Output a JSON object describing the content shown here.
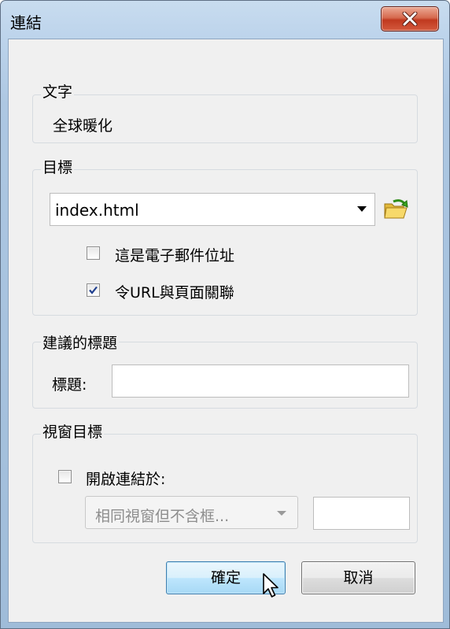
{
  "window": {
    "title": "連結"
  },
  "text_section": {
    "label": "文字",
    "value": "全球暖化"
  },
  "target_section": {
    "label": "目標",
    "combo_value": "index.html",
    "email_checkbox": {
      "label": "這是電子郵件位址",
      "checked": false
    },
    "relative_checkbox": {
      "label": "令URL與頁面關聯",
      "checked": true
    }
  },
  "title_section": {
    "label": "建議的標題",
    "field_label": "標題:",
    "field_value": ""
  },
  "window_target_section": {
    "label": "視窗目標",
    "open_checkbox": {
      "label": "開啟連結於:",
      "checked": false
    },
    "frame_select_value": "相同視窗但不含框...",
    "frame_name_value": ""
  },
  "buttons": {
    "ok": "確定",
    "cancel": "取消"
  },
  "icons": {
    "close": "close-icon",
    "folder": "open-folder-icon",
    "cursor": "mouse-pointer-icon"
  }
}
